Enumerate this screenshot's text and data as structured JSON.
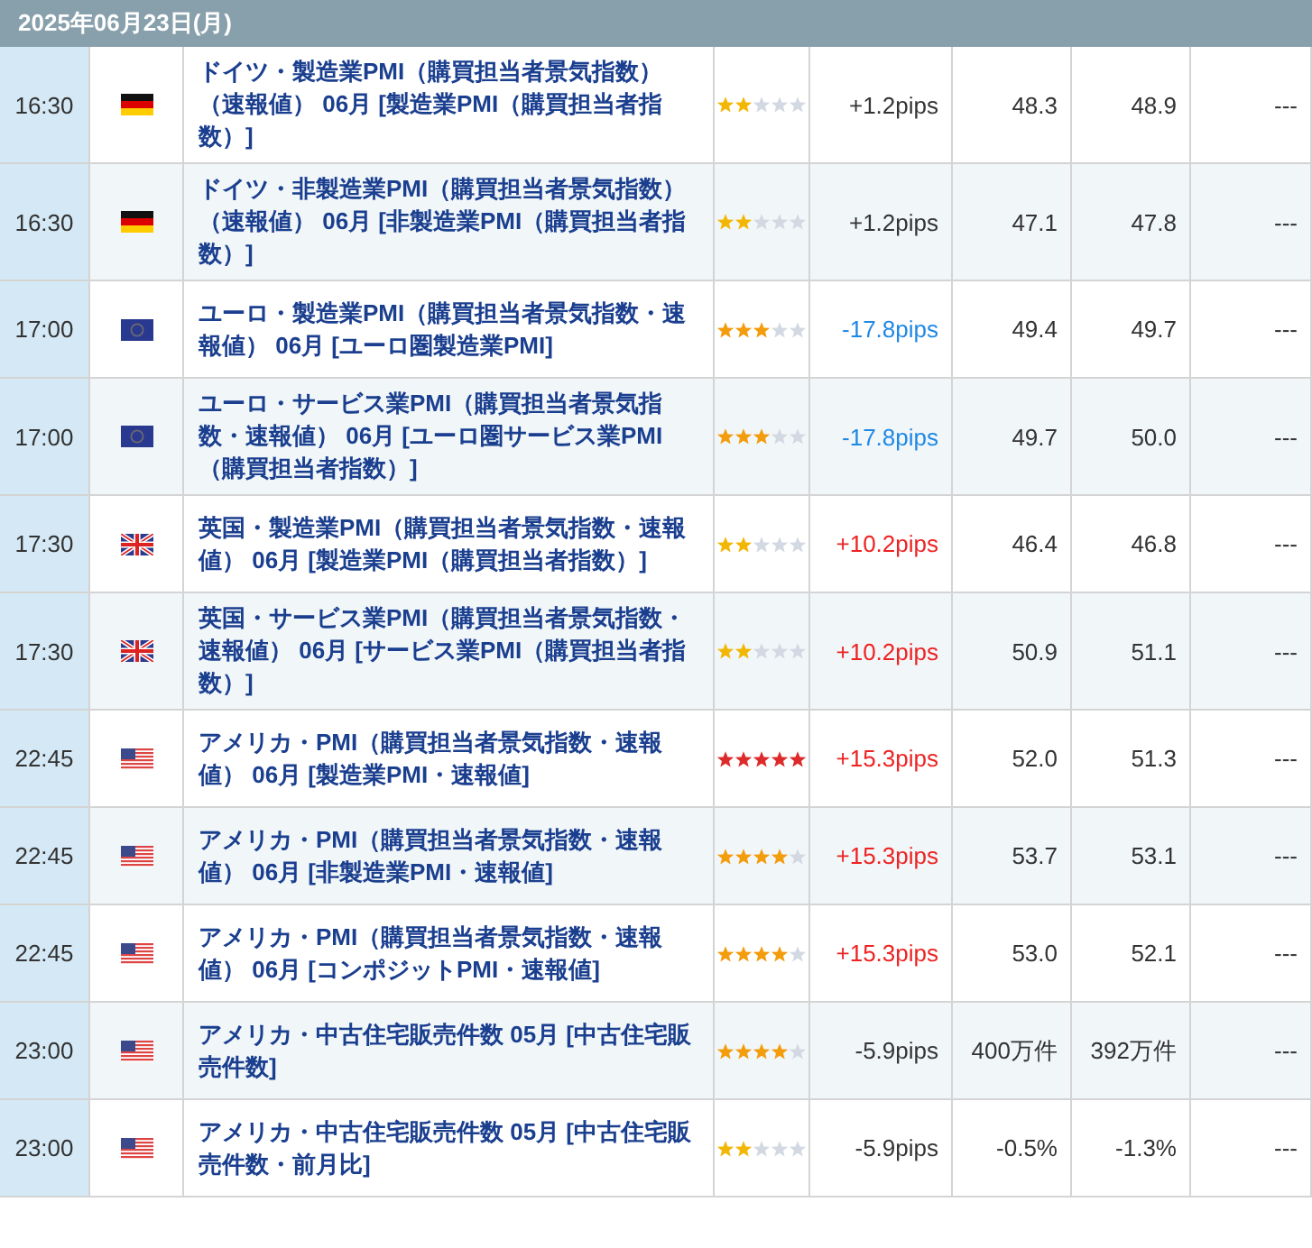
{
  "date_header": "2025年06月23日(月)",
  "rows": [
    {
      "time": "16:30",
      "flag": {
        "kind": "de"
      },
      "title": "ドイツ・製造業PMI（購買担当者景気指数）（速報値） 06月 [製造業PMI（購買担当者指数）]",
      "stars": 2,
      "pips": {
        "text": "+1.2pips",
        "color": "#333333"
      },
      "column_6": "48.3",
      "column_7": "48.9",
      "column_8": "---"
    },
    {
      "time": "16:30",
      "flag": {
        "kind": "de"
      },
      "title": "ドイツ・非製造業PMI（購買担当者景気指数）（速報値） 06月 [非製造業PMI（購買担当者指数）]",
      "stars": 2,
      "pips": {
        "text": "+1.2pips",
        "color": "#333333"
      },
      "column_6": "47.1",
      "column_7": "47.8",
      "column_8": "---"
    },
    {
      "time": "17:00",
      "flag": {
        "kind": "eu"
      },
      "title": "ユーロ・製造業PMI（購買担当者景気指数・速報値） 06月 [ユーロ圏製造業PMI]",
      "stars": 3,
      "pips": {
        "text": "-17.8pips",
        "color": "#1e88e5"
      },
      "column_6": "49.4",
      "column_7": "49.7",
      "column_8": "---"
    },
    {
      "time": "17:00",
      "flag": {
        "kind": "eu"
      },
      "title": "ユーロ・サービス業PMI（購買担当者景気指数・速報値） 06月 [ユーロ圏サービス業PMI（購買担当者指数）]",
      "stars": 3,
      "pips": {
        "text": "-17.8pips",
        "color": "#1e88e5"
      },
      "column_6": "49.7",
      "column_7": "50.0",
      "column_8": "---"
    },
    {
      "time": "17:30",
      "flag": {
        "kind": "gb"
      },
      "title": "英国・製造業PMI（購買担当者景気指数・速報値） 06月 [製造業PMI（購買担当者指数）]",
      "stars": 2,
      "pips": {
        "text": "+10.2pips",
        "color": "#ee2222"
      },
      "column_6": "46.4",
      "column_7": "46.8",
      "column_8": "---"
    },
    {
      "time": "17:30",
      "flag": {
        "kind": "gb"
      },
      "title": "英国・サービス業PMI（購買担当者景気指数・速報値） 06月 [サービス業PMI（購買担当者指数）]",
      "stars": 2,
      "pips": {
        "text": "+10.2pips",
        "color": "#ee2222"
      },
      "column_6": "50.9",
      "column_7": "51.1",
      "column_8": "---"
    },
    {
      "time": "22:45",
      "flag": {
        "kind": "us"
      },
      "title": "アメリカ・PMI（購買担当者景気指数・速報値） 06月 [製造業PMI・速報値]",
      "stars": 5,
      "pips": {
        "text": "+15.3pips",
        "color": "#ee2222"
      },
      "column_6": "52.0",
      "column_7": "51.3",
      "column_8": "---"
    },
    {
      "time": "22:45",
      "flag": {
        "kind": "us"
      },
      "title": "アメリカ・PMI（購買担当者景気指数・速報値） 06月 [非製造業PMI・速報値]",
      "stars": 4,
      "pips": {
        "text": "+15.3pips",
        "color": "#ee2222"
      },
      "column_6": "53.7",
      "column_7": "53.1",
      "column_8": "---"
    },
    {
      "time": "22:45",
      "flag": {
        "kind": "us"
      },
      "title": "アメリカ・PMI（購買担当者景気指数・速報値） 06月 [コンポジットPMI・速報値]",
      "stars": 4,
      "pips": {
        "text": "+15.3pips",
        "color": "#ee2222"
      },
      "column_6": "53.0",
      "column_7": "52.1",
      "column_8": "---"
    },
    {
      "time": "23:00",
      "flag": {
        "kind": "us"
      },
      "title": "アメリカ・中古住宅販売件数 05月 [中古住宅販売件数]",
      "stars": 4,
      "pips": {
        "text": "-5.9pips",
        "color": "#333333"
      },
      "column_6": "400万件",
      "column_7": "392万件",
      "column_8": "---"
    },
    {
      "time": "23:00",
      "flag": {
        "kind": "us"
      },
      "title": "アメリカ・中古住宅販売件数 05月 [中古住宅販売件数・前月比]",
      "stars": 2,
      "pips": {
        "text": "-5.9pips",
        "color": "#333333"
      },
      "column_6": "-0.5%",
      "column_7": "-1.3%",
      "column_8": "---"
    }
  ]
}
